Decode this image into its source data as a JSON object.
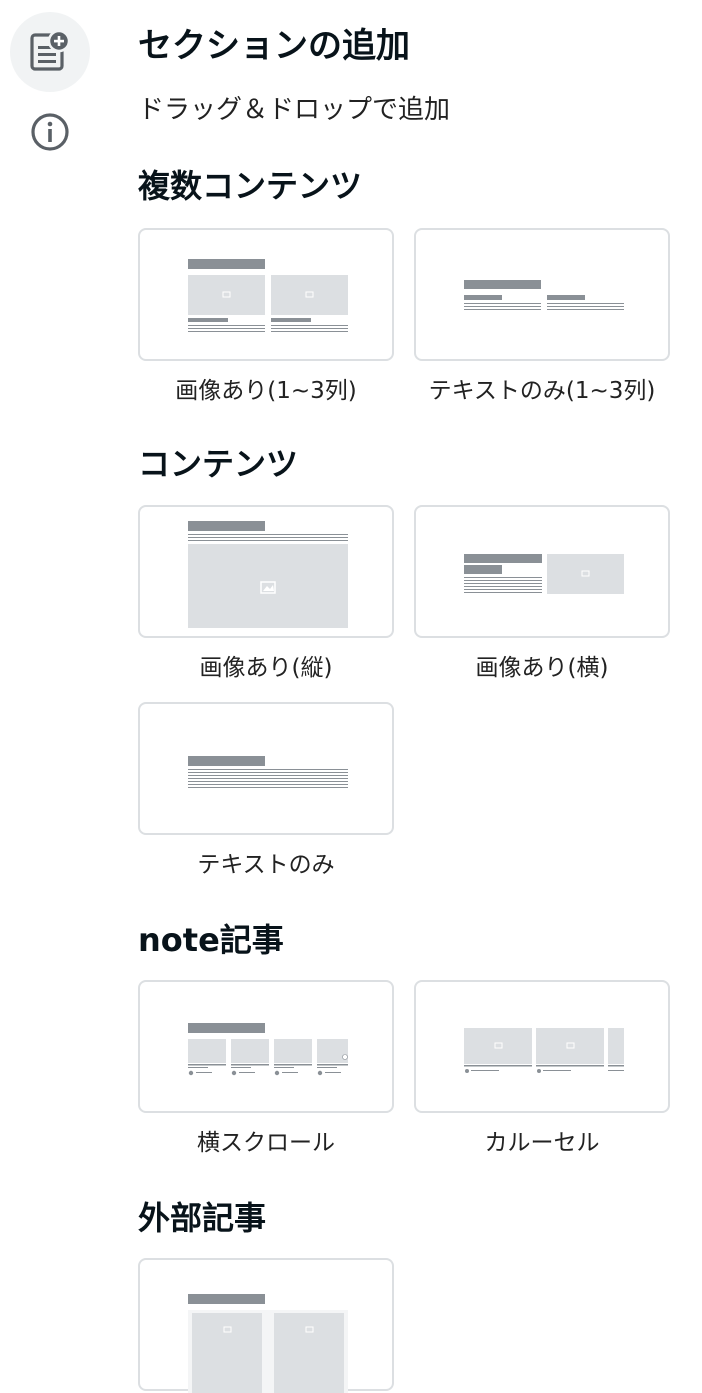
{
  "rail": {
    "add_section_icon": "note-add-icon",
    "info_icon": "info-icon"
  },
  "header": {
    "title": "セクションの追加",
    "subtitle": "ドラッグ＆ドロップで追加"
  },
  "sections": [
    {
      "heading": "複数コンテンツ",
      "items": [
        {
          "label": "画像あり(1~3列)",
          "thumbnail": "multi-with-image"
        },
        {
          "label": "テキストのみ(1~3列)",
          "thumbnail": "multi-text-only"
        }
      ]
    },
    {
      "heading": "コンテンツ",
      "items": [
        {
          "label": "画像あり(縦)",
          "thumbnail": "image-vertical"
        },
        {
          "label": "画像あり(横)",
          "thumbnail": "image-horizontal"
        },
        {
          "label": "テキストのみ",
          "thumbnail": "text-only"
        }
      ]
    },
    {
      "heading": "note記事",
      "items": [
        {
          "label": "横スクロール",
          "thumbnail": "horizontal-scroll"
        },
        {
          "label": "カルーセル",
          "thumbnail": "carousel"
        }
      ]
    },
    {
      "heading": "外部記事",
      "items": [
        {
          "label": "",
          "thumbnail": "external-articles"
        }
      ]
    }
  ],
  "colors": {
    "thumb_dark": "#8a9096",
    "thumb_light": "#dcdfe2",
    "card_border": "#dcdfe2",
    "rail_active_bg": "#f1f3f4",
    "icon": "#5a6066"
  }
}
